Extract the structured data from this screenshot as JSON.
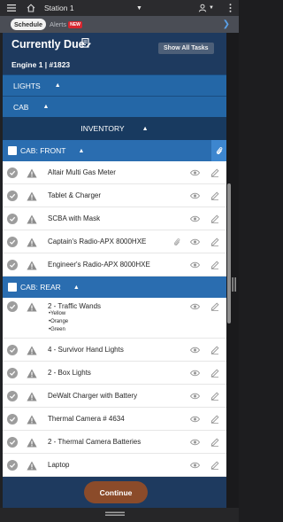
{
  "topbar": {
    "menu_icon": "hamburger-icon",
    "home_icon": "home-icon",
    "station": "Station 1",
    "dropdown_icon": "caret-down-icon",
    "user_icon": "user-icon",
    "more_icon": "kebab-icon"
  },
  "tabs": {
    "schedule": "Schedule",
    "alerts": "Alerts",
    "new_badge": "NEW",
    "chevron_icon": "chevron-right-icon"
  },
  "header": {
    "title": "Currently Due",
    "show_all": "Show All Tasks",
    "unit": "Engine 1 | #1823"
  },
  "sections": {
    "lights": "LIGHTS",
    "cab": "CAB",
    "inventory": "INVENTORY",
    "caret": "▲"
  },
  "front": {
    "title": "CAB: FRONT",
    "items": [
      {
        "label": "Altair Multi Gas Meter"
      },
      {
        "label": "Tablet & Charger"
      },
      {
        "label": "SCBA with Mask"
      },
      {
        "label": "Captain's Radio-APX 8000HXE"
      },
      {
        "label": "Engineer's Radio-APX 8000HXE"
      }
    ]
  },
  "rear": {
    "title": "CAB: REAR",
    "items": [
      {
        "label": "2 - Traffic Wands",
        "sub": [
          "•Yellow",
          "•Orange",
          "•Green"
        ]
      },
      {
        "label": "4 - Survivor Hand Lights"
      },
      {
        "label": "2 - Box Lights"
      },
      {
        "label": "DeWalt Charger with Battery"
      },
      {
        "label": "Thermal Camera # 4634"
      },
      {
        "label": "2 - Thermal Camera Batteries"
      },
      {
        "label": "Laptop"
      }
    ]
  },
  "footer": {
    "continue": "Continue"
  },
  "colors": {
    "header_navy": "#1e3a5f",
    "section_blue": "#2467a7",
    "continue_btn": "#8b4b2a",
    "alert_red": "#d8262f"
  }
}
